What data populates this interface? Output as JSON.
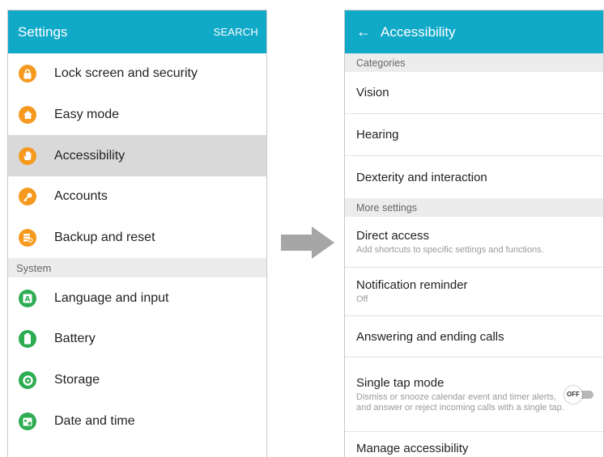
{
  "left": {
    "header": {
      "title": "Settings",
      "search": "SEARCH"
    },
    "items_top": [
      {
        "label": "Lock screen and security",
        "icon": "lock-icon",
        "glyph": "🔒"
      },
      {
        "label": "Easy mode",
        "icon": "home-icon",
        "glyph": "⌂"
      },
      {
        "label": "Accessibility",
        "icon": "hand-icon",
        "glyph": "✋",
        "selected": true
      },
      {
        "label": "Accounts",
        "icon": "key-icon",
        "glyph": "⚷"
      },
      {
        "label": "Backup and reset",
        "icon": "backup-icon",
        "glyph": "⟲"
      }
    ],
    "section_system": "System",
    "items_system": [
      {
        "label": "Language and input",
        "icon": "language-icon",
        "glyph": "A"
      },
      {
        "label": "Battery",
        "icon": "battery-icon",
        "glyph": "▮"
      },
      {
        "label": "Storage",
        "icon": "storage-icon",
        "glyph": "◔"
      },
      {
        "label": "Date and time",
        "icon": "calendar-icon",
        "glyph": "▦"
      }
    ]
  },
  "right": {
    "header": {
      "back": "←",
      "title": "Accessibility"
    },
    "section_categories": "Categories",
    "categories": [
      "Vision",
      "Hearing",
      "Dexterity and interaction"
    ],
    "section_more": "More settings",
    "direct_access": {
      "label": "Direct access",
      "sub": "Add shortcuts to specific settings and functions."
    },
    "notification_reminder": {
      "label": "Notification reminder",
      "sub": "Off"
    },
    "answering": {
      "label": "Answering and ending calls"
    },
    "single_tap": {
      "label": "Single tap mode",
      "sub": "Dismiss or snooze calendar event and timer alerts, and answer or reject incoming calls with a single tap.",
      "toggle": "OFF"
    },
    "manage": {
      "label": "Manage accessibility"
    }
  },
  "colors": {
    "header": "#11a9c8",
    "icon_orange": "#f59a1f",
    "icon_green": "#2dac52",
    "selected_row": "#d9d9d9"
  }
}
